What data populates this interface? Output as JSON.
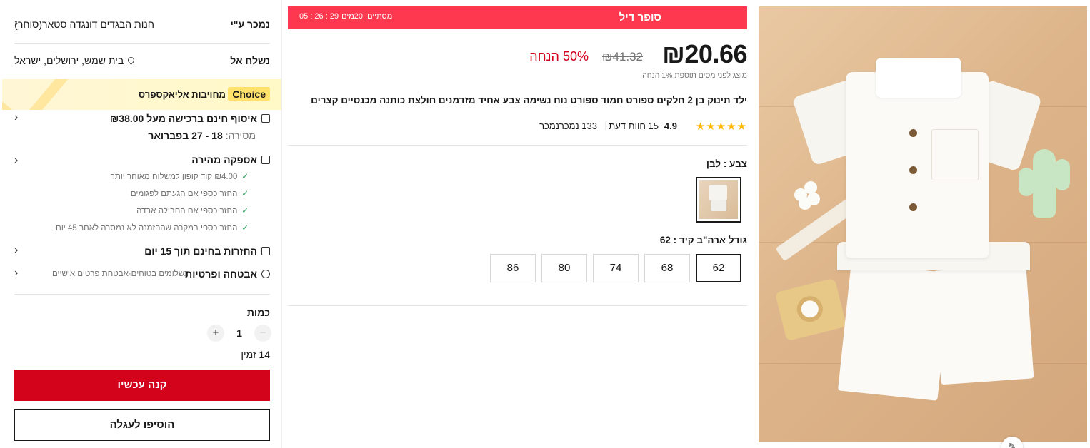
{
  "sidebar": {
    "seller": {
      "label": "נמכר ע\"י",
      "store": "חנות הבגדים דונגדה סטאר(סוחר)"
    },
    "shipping": {
      "label": "נשלח אל",
      "location": "בית שמש, ירושלים, ישראל"
    },
    "choice": {
      "tag": "Choice",
      "text": "מחויבות אליאקספרס"
    },
    "free_pickup": {
      "title": "איסוף חינם ברכישה מעל ₪38.00",
      "delivery_label": "מסירה:",
      "delivery_dates": "18 - 27 בפברואר"
    },
    "fast_delivery": {
      "title": "אספקה מהירה",
      "perks": [
        "₪4.00 קוד קופון למשלוח מאוחר יותר",
        "החזר כספי אם הגעתם לפגומים",
        "החזר כספי אם החבילה אבדה",
        "החזר כספי במקרה שההזמנה לא נמסרה לאחר 45 יום"
      ]
    },
    "returns": {
      "title": "החזרות בחינם תוך 15 יום"
    },
    "security": {
      "title": "אבטחה ופרטיות",
      "sub": "תשלומים בטוחים·אבטחת פרטים אישיים"
    },
    "quantity": {
      "label": "כמות",
      "value": "1",
      "minus": "−",
      "plus": "+",
      "available": "14 זמין"
    },
    "buy_now_label": "קנה עכשיו",
    "add_to_cart_label": "הוסיפו לעגלה"
  },
  "deal": {
    "name": "סופר דיל",
    "ends_label": "מסתיים: 20מים",
    "timer": "29 : 26 : 05"
  },
  "price": {
    "current": "₪20.66",
    "original": "₪41.32",
    "discount": "50% הנחה",
    "tax_note": "מוצג לפני מסים תוספת 1% הנחה"
  },
  "product": {
    "title": "ילד תינוק בן 2 חלקים ספורט חמוד ספורט נוח נשימה צבע אחיד מזדמנים חולצת כותנה מכנסיים קצרים",
    "rating": 4.9,
    "rating_text": "4.9",
    "stars": "★★★★★",
    "reviews": "15 חוות דעת",
    "separator": "|",
    "sold": "133 נמכרנמכר"
  },
  "color": {
    "label": "צבע : לבן",
    "selected": "לבן"
  },
  "size": {
    "label": "גודל ארה\"ב קיד : 62",
    "options": [
      "62",
      "68",
      "74",
      "80",
      "86"
    ],
    "selected": "62"
  },
  "icons": {
    "chevron": "‹",
    "tick": "✓",
    "edit": "✎"
  },
  "colors": {
    "accent_red": "#d3031c",
    "deal_bar": "#fd384f",
    "star": "#ffb800",
    "choice_tag": "#ffe16b"
  }
}
